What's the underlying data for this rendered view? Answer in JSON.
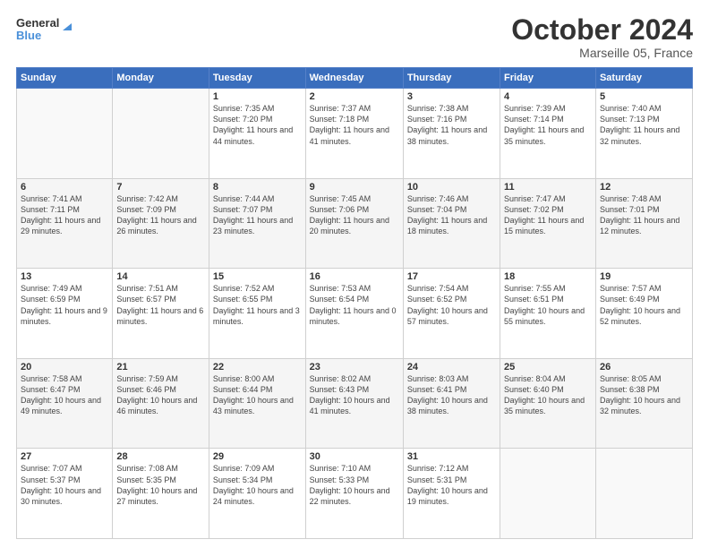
{
  "header": {
    "logo_line1": "General",
    "logo_line2": "Blue",
    "month": "October 2024",
    "location": "Marseille 05, France"
  },
  "weekdays": [
    "Sunday",
    "Monday",
    "Tuesday",
    "Wednesday",
    "Thursday",
    "Friday",
    "Saturday"
  ],
  "weeks": [
    [
      {
        "day": "",
        "sunrise": "",
        "sunset": "",
        "daylight": ""
      },
      {
        "day": "",
        "sunrise": "",
        "sunset": "",
        "daylight": ""
      },
      {
        "day": "1",
        "sunrise": "Sunrise: 7:35 AM",
        "sunset": "Sunset: 7:20 PM",
        "daylight": "Daylight: 11 hours and 44 minutes."
      },
      {
        "day": "2",
        "sunrise": "Sunrise: 7:37 AM",
        "sunset": "Sunset: 7:18 PM",
        "daylight": "Daylight: 11 hours and 41 minutes."
      },
      {
        "day": "3",
        "sunrise": "Sunrise: 7:38 AM",
        "sunset": "Sunset: 7:16 PM",
        "daylight": "Daylight: 11 hours and 38 minutes."
      },
      {
        "day": "4",
        "sunrise": "Sunrise: 7:39 AM",
        "sunset": "Sunset: 7:14 PM",
        "daylight": "Daylight: 11 hours and 35 minutes."
      },
      {
        "day": "5",
        "sunrise": "Sunrise: 7:40 AM",
        "sunset": "Sunset: 7:13 PM",
        "daylight": "Daylight: 11 hours and 32 minutes."
      }
    ],
    [
      {
        "day": "6",
        "sunrise": "Sunrise: 7:41 AM",
        "sunset": "Sunset: 7:11 PM",
        "daylight": "Daylight: 11 hours and 29 minutes."
      },
      {
        "day": "7",
        "sunrise": "Sunrise: 7:42 AM",
        "sunset": "Sunset: 7:09 PM",
        "daylight": "Daylight: 11 hours and 26 minutes."
      },
      {
        "day": "8",
        "sunrise": "Sunrise: 7:44 AM",
        "sunset": "Sunset: 7:07 PM",
        "daylight": "Daylight: 11 hours and 23 minutes."
      },
      {
        "day": "9",
        "sunrise": "Sunrise: 7:45 AM",
        "sunset": "Sunset: 7:06 PM",
        "daylight": "Daylight: 11 hours and 20 minutes."
      },
      {
        "day": "10",
        "sunrise": "Sunrise: 7:46 AM",
        "sunset": "Sunset: 7:04 PM",
        "daylight": "Daylight: 11 hours and 18 minutes."
      },
      {
        "day": "11",
        "sunrise": "Sunrise: 7:47 AM",
        "sunset": "Sunset: 7:02 PM",
        "daylight": "Daylight: 11 hours and 15 minutes."
      },
      {
        "day": "12",
        "sunrise": "Sunrise: 7:48 AM",
        "sunset": "Sunset: 7:01 PM",
        "daylight": "Daylight: 11 hours and 12 minutes."
      }
    ],
    [
      {
        "day": "13",
        "sunrise": "Sunrise: 7:49 AM",
        "sunset": "Sunset: 6:59 PM",
        "daylight": "Daylight: 11 hours and 9 minutes."
      },
      {
        "day": "14",
        "sunrise": "Sunrise: 7:51 AM",
        "sunset": "Sunset: 6:57 PM",
        "daylight": "Daylight: 11 hours and 6 minutes."
      },
      {
        "day": "15",
        "sunrise": "Sunrise: 7:52 AM",
        "sunset": "Sunset: 6:55 PM",
        "daylight": "Daylight: 11 hours and 3 minutes."
      },
      {
        "day": "16",
        "sunrise": "Sunrise: 7:53 AM",
        "sunset": "Sunset: 6:54 PM",
        "daylight": "Daylight: 11 hours and 0 minutes."
      },
      {
        "day": "17",
        "sunrise": "Sunrise: 7:54 AM",
        "sunset": "Sunset: 6:52 PM",
        "daylight": "Daylight: 10 hours and 57 minutes."
      },
      {
        "day": "18",
        "sunrise": "Sunrise: 7:55 AM",
        "sunset": "Sunset: 6:51 PM",
        "daylight": "Daylight: 10 hours and 55 minutes."
      },
      {
        "day": "19",
        "sunrise": "Sunrise: 7:57 AM",
        "sunset": "Sunset: 6:49 PM",
        "daylight": "Daylight: 10 hours and 52 minutes."
      }
    ],
    [
      {
        "day": "20",
        "sunrise": "Sunrise: 7:58 AM",
        "sunset": "Sunset: 6:47 PM",
        "daylight": "Daylight: 10 hours and 49 minutes."
      },
      {
        "day": "21",
        "sunrise": "Sunrise: 7:59 AM",
        "sunset": "Sunset: 6:46 PM",
        "daylight": "Daylight: 10 hours and 46 minutes."
      },
      {
        "day": "22",
        "sunrise": "Sunrise: 8:00 AM",
        "sunset": "Sunset: 6:44 PM",
        "daylight": "Daylight: 10 hours and 43 minutes."
      },
      {
        "day": "23",
        "sunrise": "Sunrise: 8:02 AM",
        "sunset": "Sunset: 6:43 PM",
        "daylight": "Daylight: 10 hours and 41 minutes."
      },
      {
        "day": "24",
        "sunrise": "Sunrise: 8:03 AM",
        "sunset": "Sunset: 6:41 PM",
        "daylight": "Daylight: 10 hours and 38 minutes."
      },
      {
        "day": "25",
        "sunrise": "Sunrise: 8:04 AM",
        "sunset": "Sunset: 6:40 PM",
        "daylight": "Daylight: 10 hours and 35 minutes."
      },
      {
        "day": "26",
        "sunrise": "Sunrise: 8:05 AM",
        "sunset": "Sunset: 6:38 PM",
        "daylight": "Daylight: 10 hours and 32 minutes."
      }
    ],
    [
      {
        "day": "27",
        "sunrise": "Sunrise: 7:07 AM",
        "sunset": "Sunset: 5:37 PM",
        "daylight": "Daylight: 10 hours and 30 minutes."
      },
      {
        "day": "28",
        "sunrise": "Sunrise: 7:08 AM",
        "sunset": "Sunset: 5:35 PM",
        "daylight": "Daylight: 10 hours and 27 minutes."
      },
      {
        "day": "29",
        "sunrise": "Sunrise: 7:09 AM",
        "sunset": "Sunset: 5:34 PM",
        "daylight": "Daylight: 10 hours and 24 minutes."
      },
      {
        "day": "30",
        "sunrise": "Sunrise: 7:10 AM",
        "sunset": "Sunset: 5:33 PM",
        "daylight": "Daylight: 10 hours and 22 minutes."
      },
      {
        "day": "31",
        "sunrise": "Sunrise: 7:12 AM",
        "sunset": "Sunset: 5:31 PM",
        "daylight": "Daylight: 10 hours and 19 minutes."
      },
      {
        "day": "",
        "sunrise": "",
        "sunset": "",
        "daylight": ""
      },
      {
        "day": "",
        "sunrise": "",
        "sunset": "",
        "daylight": ""
      }
    ]
  ]
}
